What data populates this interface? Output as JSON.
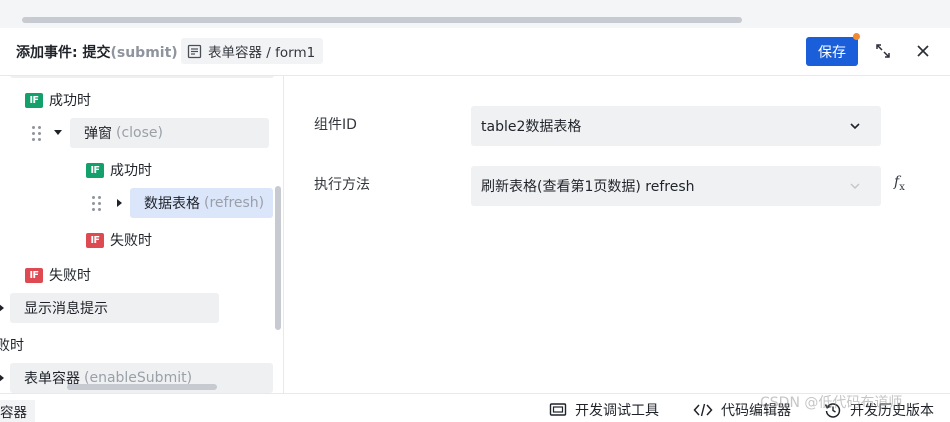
{
  "header": {
    "title": "添加事件: 提交",
    "title_sub": "(submit)",
    "crumb": "表单容器 / form1",
    "save_label": "保存"
  },
  "tree": {
    "success_top": "成功时",
    "modal_label": "弹窗",
    "modal_hint": "(close)",
    "success_inner": "成功时",
    "table_label": "数据表格",
    "table_hint": "(refresh)",
    "fail_inner": "失败时",
    "fail_outer": "失败时",
    "toast_label": "显示消息提示",
    "fail_partial": "败时",
    "form_label": "表单容器",
    "form_hint": "(enableSubmit)",
    "badge_text": "IF"
  },
  "form": {
    "component_label": "组件ID",
    "component_value": "table2数据表格",
    "method_label": "执行方法",
    "method_value": "刷新表格(查看第1页数据) refresh",
    "fx_label": "f",
    "fx_sub": "x"
  },
  "footer": {
    "left_tag": "容器",
    "debug_tool": "开发调试工具",
    "code_editor": "代码编辑器",
    "history": "开发历史版本"
  },
  "watermark": "CSDN @低代码布道师",
  "colors": {
    "primary": "#1a5fd9",
    "success_badge": "#14a06a",
    "fail_badge": "#de4a52",
    "selected_bg": "#dbe6fb",
    "notify_dot": "#ef8a37"
  }
}
